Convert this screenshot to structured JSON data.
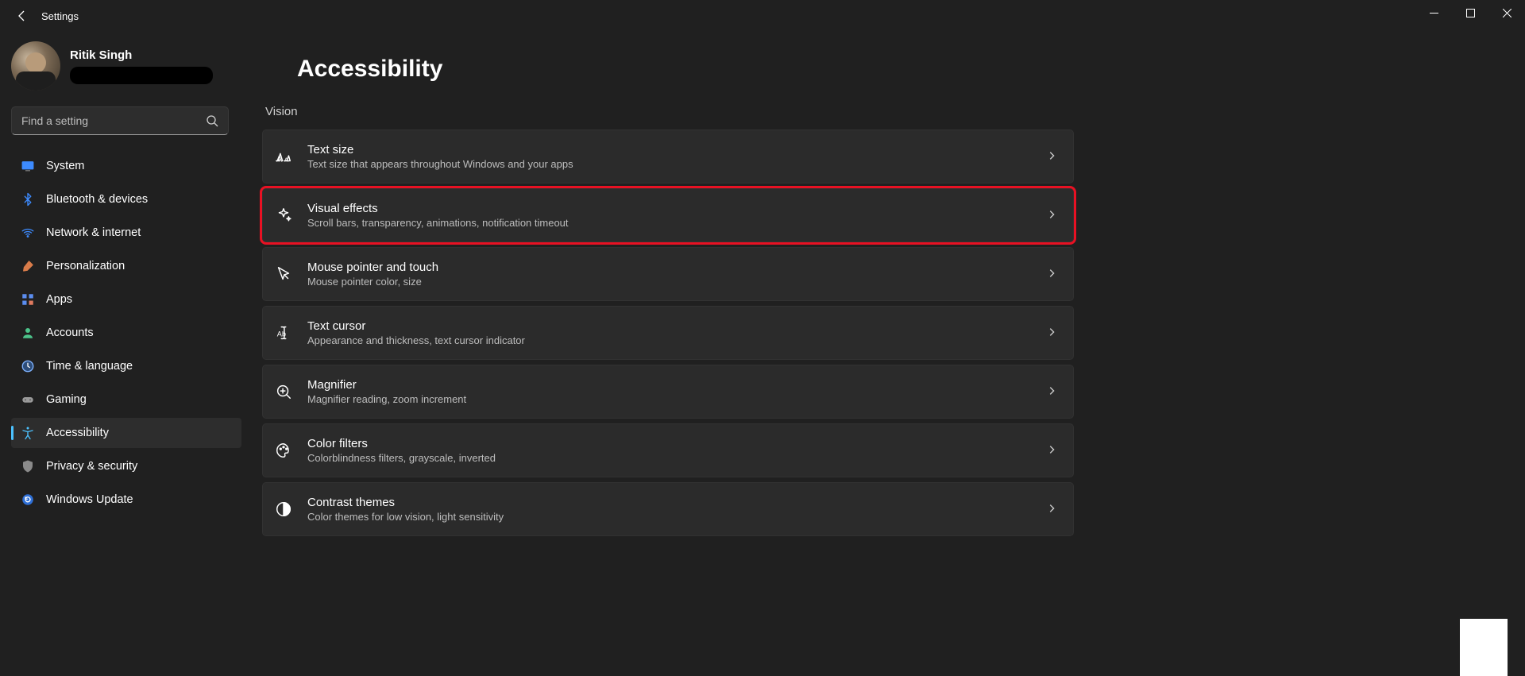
{
  "window": {
    "title": "Settings"
  },
  "profile": {
    "name": "Ritik Singh"
  },
  "search": {
    "placeholder": "Find a setting"
  },
  "nav": {
    "items": [
      {
        "label": "System",
        "icon": "system"
      },
      {
        "label": "Bluetooth & devices",
        "icon": "bluetooth"
      },
      {
        "label": "Network & internet",
        "icon": "wifi"
      },
      {
        "label": "Personalization",
        "icon": "brush"
      },
      {
        "label": "Apps",
        "icon": "apps"
      },
      {
        "label": "Accounts",
        "icon": "person"
      },
      {
        "label": "Time & language",
        "icon": "clock"
      },
      {
        "label": "Gaming",
        "icon": "gamepad"
      },
      {
        "label": "Accessibility",
        "icon": "accessibility"
      },
      {
        "label": "Privacy & security",
        "icon": "shield"
      },
      {
        "label": "Windows Update",
        "icon": "update"
      }
    ],
    "active_index": 8
  },
  "page": {
    "title": "Accessibility",
    "section": "Vision",
    "items": [
      {
        "icon": "text-size",
        "title": "Text size",
        "desc": "Text size that appears throughout Windows and your apps"
      },
      {
        "icon": "sparkle",
        "title": "Visual effects",
        "desc": "Scroll bars, transparency, animations, notification timeout",
        "highlighted": true
      },
      {
        "icon": "pointer",
        "title": "Mouse pointer and touch",
        "desc": "Mouse pointer color, size"
      },
      {
        "icon": "text-cursor",
        "title": "Text cursor",
        "desc": "Appearance and thickness, text cursor indicator"
      },
      {
        "icon": "magnifier",
        "title": "Magnifier",
        "desc": "Magnifier reading, zoom increment"
      },
      {
        "icon": "palette",
        "title": "Color filters",
        "desc": "Colorblindness filters, grayscale, inverted"
      },
      {
        "icon": "contrast",
        "title": "Contrast themes",
        "desc": "Color themes for low vision, light sensitivity"
      }
    ]
  }
}
